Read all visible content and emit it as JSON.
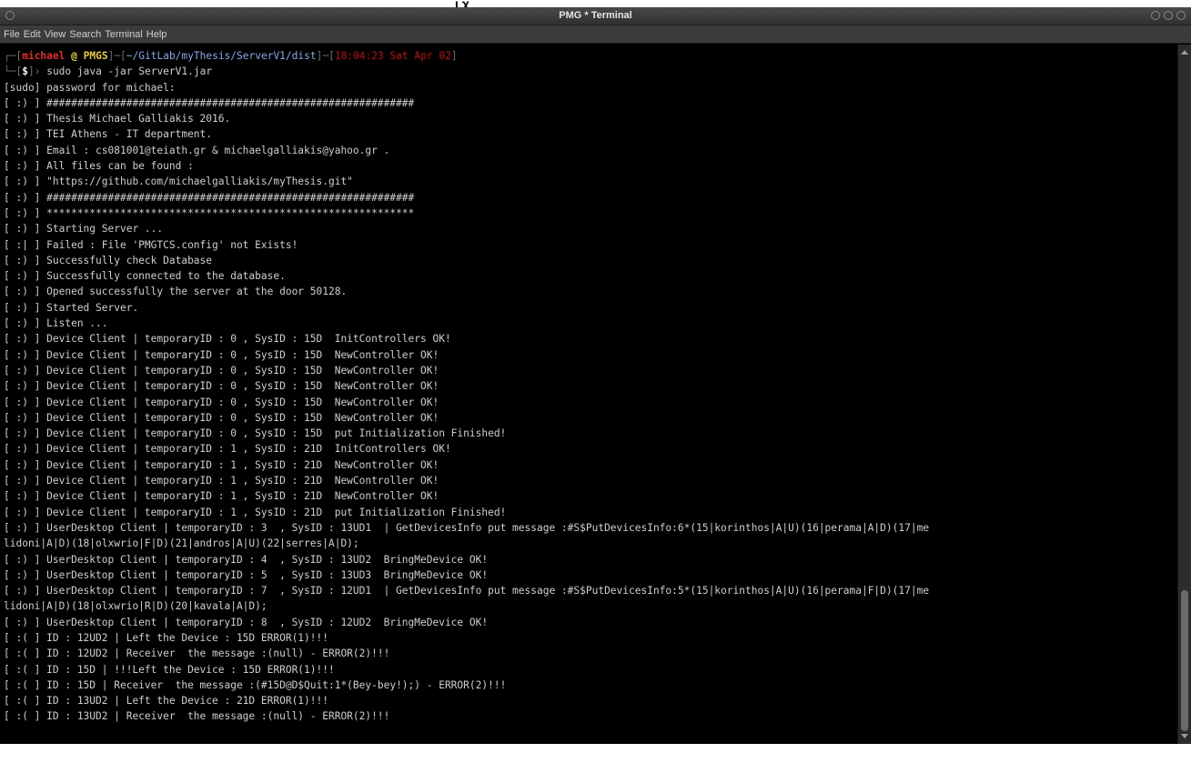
{
  "top_crop_text": "ι χ",
  "window": {
    "title": "PMG * Terminal"
  },
  "menu": [
    "File",
    "Edit",
    "View",
    "Search",
    "Terminal",
    "Help"
  ],
  "prompt": {
    "user": "michael",
    "at": "@",
    "host": "PMGS",
    "path": "~/GitLab/myThesis/ServerV1/dist",
    "time": "18:04:23 Sat Apr 02",
    "symbol": "$",
    "command": "sudo java -jar ServerV1.jar"
  },
  "lines": [
    "[sudo] password for michael:",
    "[ :) ] ############################################################",
    "[ :) ] Thesis Michael Galliakis 2016.",
    "[ :) ] TEI Athens - IT department.",
    "[ :) ] Email : cs081001@teiath.gr & michaelgalliakis@yahoo.gr .",
    "[ :) ] All files can be found :",
    "[ :) ] \"https://github.com/michaelgalliakis/myThesis.git\"",
    "[ :) ] ############################################################",
    "[ :) ] ************************************************************",
    "[ :) ] Starting Server ...",
    "[ :| ] Failed : File 'PMGTCS.config' not Exists!",
    "[ :) ] Successfully check Database",
    "[ :) ] Successfully connected to the database.",
    "[ :) ] Opened successfully the server at the door 50128.",
    "[ :) ] Started Server.",
    "[ :) ] Listen ...",
    "[ :) ] Device Client | temporaryID : 0 , SysID : 15D  InitControllers OK!",
    "[ :) ] Device Client | temporaryID : 0 , SysID : 15D  NewController OK!",
    "[ :) ] Device Client | temporaryID : 0 , SysID : 15D  NewController OK!",
    "[ :) ] Device Client | temporaryID : 0 , SysID : 15D  NewController OK!",
    "[ :) ] Device Client | temporaryID : 0 , SysID : 15D  NewController OK!",
    "[ :) ] Device Client | temporaryID : 0 , SysID : 15D  NewController OK!",
    "[ :) ] Device Client | temporaryID : 0 , SysID : 15D  put Initialization Finished!",
    "[ :) ] Device Client | temporaryID : 1 , SysID : 21D  InitControllers OK!",
    "[ :) ] Device Client | temporaryID : 1 , SysID : 21D  NewController OK!",
    "[ :) ] Device Client | temporaryID : 1 , SysID : 21D  NewController OK!",
    "[ :) ] Device Client | temporaryID : 1 , SysID : 21D  NewController OK!",
    "[ :) ] Device Client | temporaryID : 1 , SysID : 21D  put Initialization Finished!",
    "[ :) ] UserDesktop Client | temporaryID : 3  , SysID : 13UD1  | GetDevicesInfo put message :#S$PutDevicesInfo:6*(15|korinthos|A|U)(16|perama|A|D)(17|me",
    "lidoni|A|D)(18|olxwrio|F|D)(21|andros|A|U)(22|serres|A|D);",
    "[ :) ] UserDesktop Client | temporaryID : 4  , SysID : 13UD2  BringMeDevice OK!",
    "[ :) ] UserDesktop Client | temporaryID : 5  , SysID : 13UD3  BringMeDevice OK!",
    "[ :) ] UserDesktop Client | temporaryID : 7  , SysID : 12UD1  | GetDevicesInfo put message :#S$PutDevicesInfo:5*(15|korinthos|A|U)(16|perama|F|D)(17|me",
    "lidoni|A|D)(18|olxwrio|R|D)(20|kavala|A|D);",
    "[ :) ] UserDesktop Client | temporaryID : 8  , SysID : 12UD2  BringMeDevice OK!",
    "[ :( ] ID : 12UD2 | Left the Device : 15D ERROR(1)!!!",
    "[ :( ] ID : 12UD2 | Receiver  the message :(null) - ERROR(2)!!!",
    "[ :( ] ID : 15D | !!!Left the Device : 15D ERROR(1)!!!",
    "[ :( ] ID : 15D | Receiver  the message :(#15D@D$Quit:1*(Bey-bey!);) - ERROR(2)!!!",
    "[ :( ] ID : 13UD2 | Left the Device : 21D ERROR(1)!!!",
    "[ :( ] ID : 13UD2 | Receiver  the message :(null) - ERROR(2)!!!"
  ]
}
